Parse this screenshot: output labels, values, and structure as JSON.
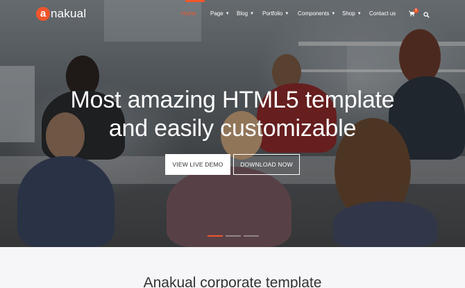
{
  "brand": {
    "logo_letter": "a",
    "logo_text": "nakual",
    "accent": "#f0552b"
  },
  "nav": {
    "items": [
      {
        "label": "Home",
        "active": true,
        "dropdown": false
      },
      {
        "label": "Page",
        "active": false,
        "dropdown": true
      },
      {
        "label": "Blog",
        "active": false,
        "dropdown": true
      },
      {
        "label": "Portfolio",
        "active": false,
        "dropdown": true
      },
      {
        "label": "Components",
        "active": false,
        "dropdown": true
      },
      {
        "label": "Shop",
        "active": false,
        "dropdown": true
      },
      {
        "label": "Contact us",
        "active": false,
        "dropdown": false
      }
    ],
    "cart_count": "1",
    "icons": {
      "cart": "cart-icon",
      "search": "search-icon",
      "dropdown": "chevron-down-icon"
    }
  },
  "hero": {
    "headline_line1": "Most amazing HTML5 template",
    "headline_line2": "and easily customizable",
    "primary_button": "VIEW LIVE DEMO",
    "secondary_button": "DOWNLOAD NOW",
    "slides": 3,
    "active_slide": 1
  },
  "section": {
    "title": "Anakual corporate template"
  }
}
